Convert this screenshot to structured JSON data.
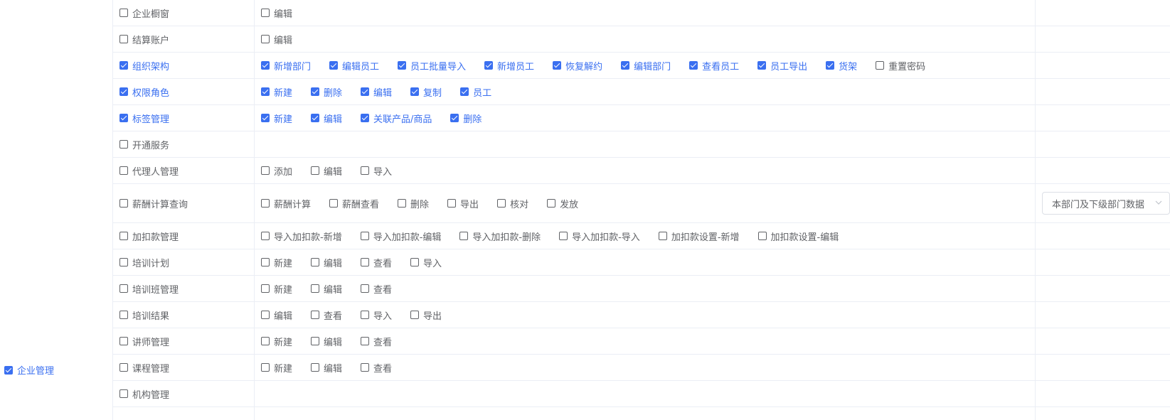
{
  "module": {
    "label": "企业管理",
    "checked": true
  },
  "rows": [
    {
      "name": "企业橱窗",
      "checked": false,
      "ops": [
        {
          "label": "编辑",
          "checked": false
        }
      ]
    },
    {
      "name": "结算账户",
      "checked": false,
      "ops": [
        {
          "label": "编辑",
          "checked": false
        }
      ]
    },
    {
      "name": "组织架构",
      "checked": true,
      "ops": [
        {
          "label": "新增部门",
          "checked": true
        },
        {
          "label": "编辑员工",
          "checked": true
        },
        {
          "label": "员工批量导入",
          "checked": true
        },
        {
          "label": "新增员工",
          "checked": true
        },
        {
          "label": "恢复解约",
          "checked": true
        },
        {
          "label": "编辑部门",
          "checked": true
        },
        {
          "label": "查看员工",
          "checked": true
        },
        {
          "label": "员工导出",
          "checked": true
        },
        {
          "label": "货架",
          "checked": true
        },
        {
          "label": "重置密码",
          "checked": false
        }
      ]
    },
    {
      "name": "权限角色",
      "checked": true,
      "ops": [
        {
          "label": "新建",
          "checked": true
        },
        {
          "label": "删除",
          "checked": true
        },
        {
          "label": "编辑",
          "checked": true
        },
        {
          "label": "复制",
          "checked": true
        },
        {
          "label": "员工",
          "checked": true
        }
      ]
    },
    {
      "name": "标签管理",
      "checked": true,
      "ops": [
        {
          "label": "新建",
          "checked": true
        },
        {
          "label": "编辑",
          "checked": true
        },
        {
          "label": "关联产品/商品",
          "checked": true
        },
        {
          "label": "删除",
          "checked": true
        }
      ]
    },
    {
      "name": "开通服务",
      "checked": false,
      "ops": []
    },
    {
      "name": "代理人管理",
      "checked": false,
      "ops": [
        {
          "label": "添加",
          "checked": false
        },
        {
          "label": "编辑",
          "checked": false
        },
        {
          "label": "导入",
          "checked": false
        }
      ]
    },
    {
      "name": "薪酬计算查询",
      "checked": false,
      "scope": "本部门及下级部门数据",
      "ops": [
        {
          "label": "薪酬计算",
          "checked": false
        },
        {
          "label": "薪酬查看",
          "checked": false
        },
        {
          "label": "删除",
          "checked": false
        },
        {
          "label": "导出",
          "checked": false
        },
        {
          "label": "核对",
          "checked": false
        },
        {
          "label": "发放",
          "checked": false
        }
      ]
    },
    {
      "name": "加扣款管理",
      "checked": false,
      "ops": [
        {
          "label": "导入加扣款-新增",
          "checked": false
        },
        {
          "label": "导入加扣款-编辑",
          "checked": false
        },
        {
          "label": "导入加扣款-删除",
          "checked": false
        },
        {
          "label": "导入加扣款-导入",
          "checked": false
        },
        {
          "label": "加扣款设置-新增",
          "checked": false
        },
        {
          "label": "加扣款设置-编辑",
          "checked": false
        }
      ]
    },
    {
      "name": "培训计划",
      "checked": false,
      "ops": [
        {
          "label": "新建",
          "checked": false
        },
        {
          "label": "编辑",
          "checked": false
        },
        {
          "label": "查看",
          "checked": false
        },
        {
          "label": "导入",
          "checked": false
        }
      ]
    },
    {
      "name": "培训班管理",
      "checked": false,
      "ops": [
        {
          "label": "新建",
          "checked": false
        },
        {
          "label": "编辑",
          "checked": false
        },
        {
          "label": "查看",
          "checked": false
        }
      ]
    },
    {
      "name": "培训结果",
      "checked": false,
      "ops": [
        {
          "label": "编辑",
          "checked": false
        },
        {
          "label": "查看",
          "checked": false
        },
        {
          "label": "导入",
          "checked": false
        },
        {
          "label": "导出",
          "checked": false
        }
      ]
    },
    {
      "name": "讲师管理",
      "checked": false,
      "ops": [
        {
          "label": "新建",
          "checked": false
        },
        {
          "label": "编辑",
          "checked": false
        },
        {
          "label": "查看",
          "checked": false
        }
      ]
    },
    {
      "name": "课程管理",
      "checked": false,
      "ops": [
        {
          "label": "新建",
          "checked": false
        },
        {
          "label": "编辑",
          "checked": false
        },
        {
          "label": "查看",
          "checked": false
        }
      ]
    },
    {
      "name": "机构管理",
      "checked": false,
      "ops": []
    }
  ],
  "colors": {
    "accent": "#3a6ff0",
    "text": "#606266",
    "border": "#ebeef5"
  },
  "icons": {
    "checkbox": "checkbox-icon",
    "dropdown": "chevron-down-icon"
  }
}
